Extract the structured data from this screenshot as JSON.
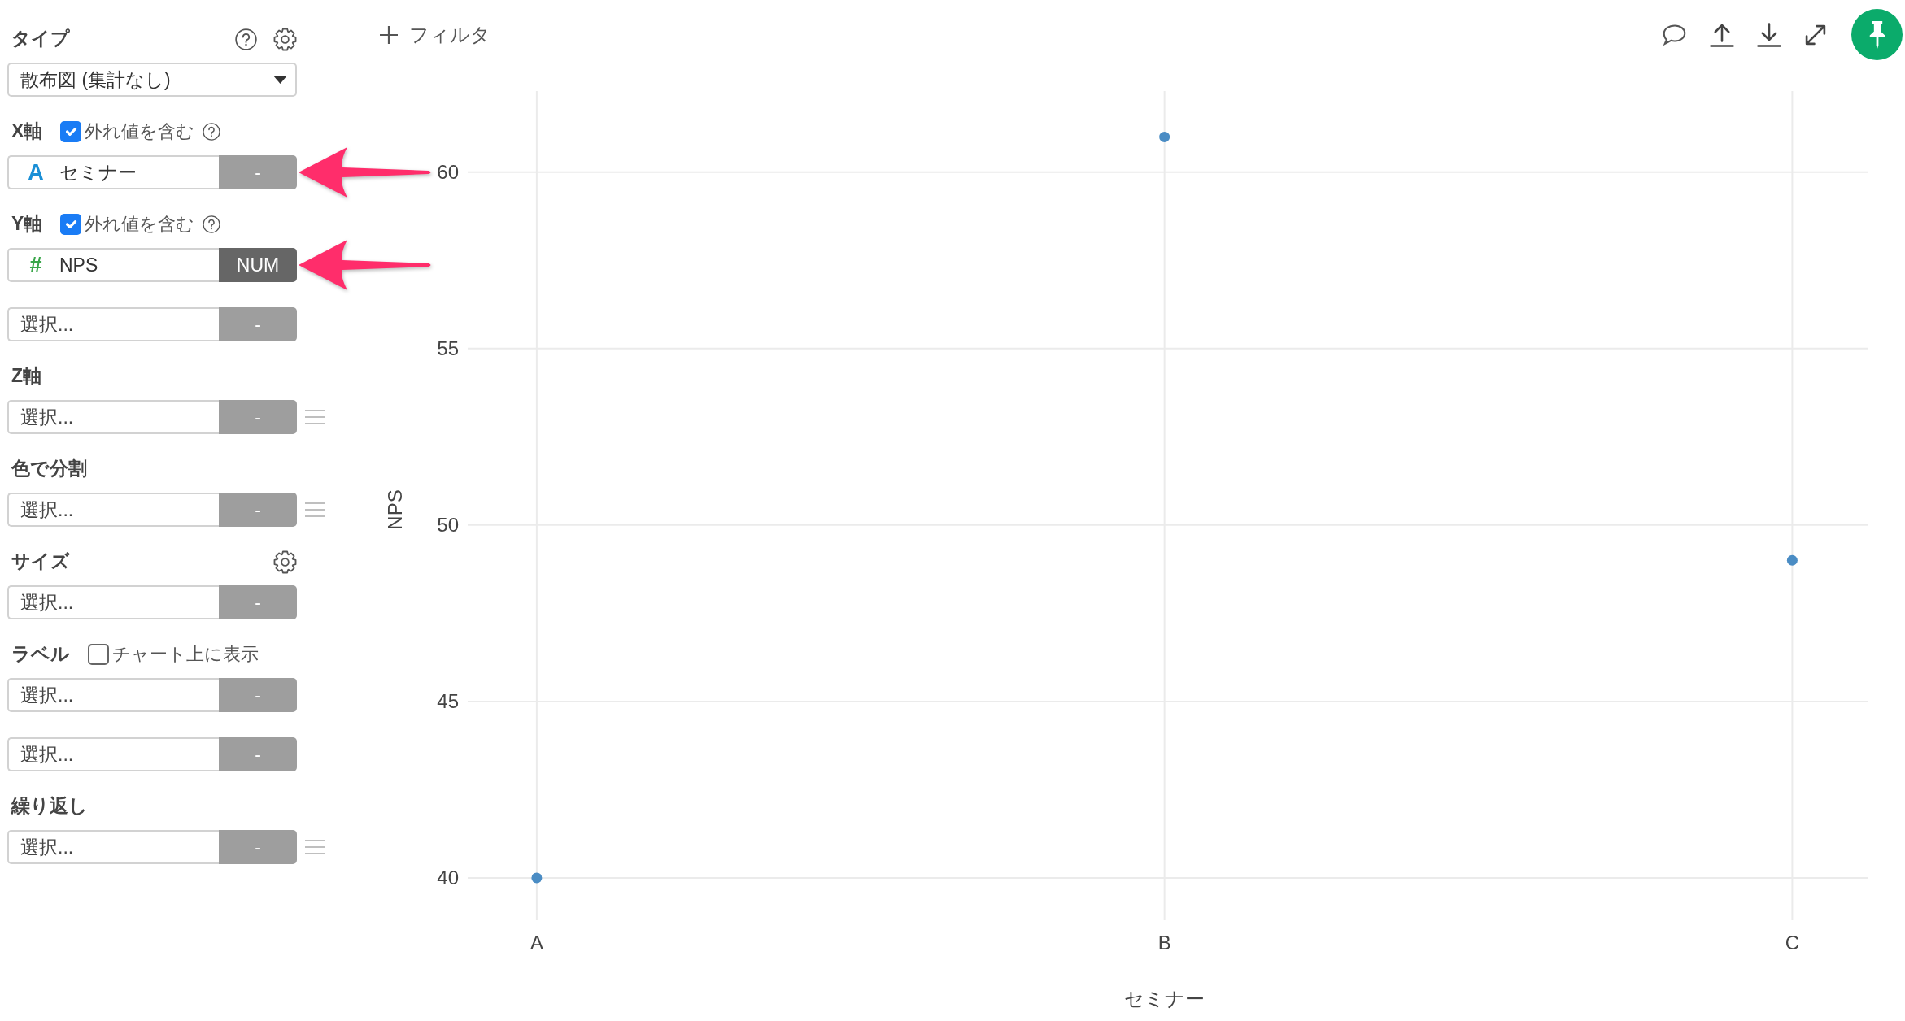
{
  "sidebar": {
    "sections": [
      {
        "label": "タイプ",
        "help": true,
        "settings": true,
        "fields": [
          {
            "kind": "dropdown",
            "value": "散布図 (集計なし)"
          }
        ]
      },
      {
        "label": "X軸",
        "option": {
          "label": "外れ値を含む",
          "checked": true,
          "help": true
        },
        "fields": [
          {
            "kind": "column",
            "type_icon": {
              "kind": "text",
              "glyph": "A"
            },
            "value": "セミナー",
            "button": {
              "label": "-",
              "active": false
            },
            "menu": false,
            "callout_arrow": true
          }
        ]
      },
      {
        "label": "Y軸",
        "option": {
          "label": "外れ値を含む",
          "checked": true,
          "help": true
        },
        "fields": [
          {
            "kind": "column",
            "type_icon": {
              "kind": "number",
              "glyph": "#"
            },
            "value": "NPS",
            "button": {
              "label": "NUM",
              "active": true
            },
            "menu": false,
            "callout_arrow": true
          },
          {
            "kind": "column",
            "placeholder": "選択...",
            "button": {
              "label": "-",
              "active": false
            },
            "menu": false,
            "callout_arrow": false
          }
        ]
      },
      {
        "label": "Z軸",
        "fields": [
          {
            "kind": "column",
            "placeholder": "選択...",
            "button": {
              "label": "-",
              "active": false
            },
            "menu": true,
            "callout_arrow": false
          }
        ]
      },
      {
        "label": "色で分割",
        "fields": [
          {
            "kind": "column",
            "placeholder": "選択...",
            "button": {
              "label": "-",
              "active": false
            },
            "menu": true,
            "callout_arrow": false
          }
        ]
      },
      {
        "label": "サイズ",
        "settings": true,
        "fields": [
          {
            "kind": "column",
            "placeholder": "選択...",
            "button": {
              "label": "-",
              "active": false
            },
            "menu": false,
            "callout_arrow": false
          }
        ]
      },
      {
        "label": "ラベル",
        "option": {
          "label": "チャート上に表示",
          "checked": false
        },
        "fields": [
          {
            "kind": "column",
            "placeholder": "選択...",
            "button": {
              "label": "-",
              "active": false
            },
            "menu": false,
            "callout_arrow": false
          },
          {
            "kind": "column",
            "placeholder": "選択...",
            "button": {
              "label": "-",
              "active": false
            },
            "menu": false,
            "callout_arrow": false
          }
        ]
      },
      {
        "label": "繰り返し",
        "fields": [
          {
            "kind": "column",
            "placeholder": "選択...",
            "button": {
              "label": "-",
              "active": false
            },
            "menu": true,
            "callout_arrow": false
          }
        ]
      }
    ]
  },
  "toolbar": {
    "filter_button": "フィルタ"
  },
  "chart": {
    "chart_data": {
      "type": "scatter",
      "xlabel": "セミナー",
      "ylabel": "NPS",
      "categories": [
        "A",
        "B",
        "C"
      ],
      "series": [
        {
          "color": "#4a8cc4",
          "values": [
            40,
            61,
            49
          ]
        }
      ],
      "ylim": [
        38.8,
        62.3
      ],
      "yticks": [
        40,
        45,
        50,
        55,
        60
      ],
      "grid": true
    }
  }
}
